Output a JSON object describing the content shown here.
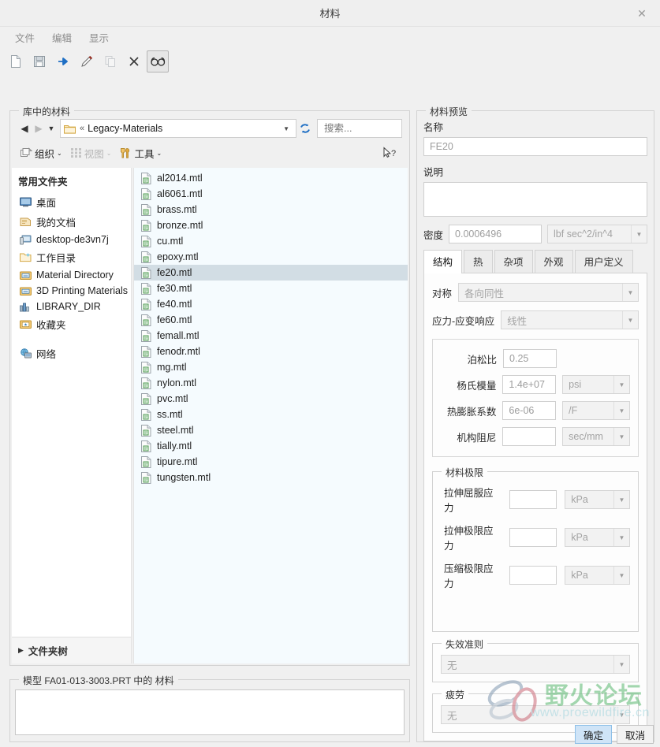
{
  "window": {
    "title": "材料",
    "close_label": "✕"
  },
  "menubar": {
    "items": [
      {
        "label": "文件",
        "icon": "file-menu"
      },
      {
        "label": "编辑",
        "icon": "edit-menu"
      },
      {
        "label": "显示",
        "icon": "view-menu"
      }
    ]
  },
  "toolbar": {
    "buttons": [
      {
        "name": "new-icon",
        "enabled": true
      },
      {
        "name": "save-icon",
        "enabled": true
      },
      {
        "name": "assign-arrow-icon",
        "enabled": true
      },
      {
        "name": "edit-pencil-icon",
        "enabled": true
      },
      {
        "name": "copy-icon",
        "enabled": false
      },
      {
        "name": "delete-x-icon",
        "enabled": true
      },
      {
        "name": "glasses-view-icon",
        "enabled": true,
        "pressed": true
      }
    ]
  },
  "library": {
    "group_title": "库中的材料",
    "nav": {
      "back": "◀",
      "forward": "▶",
      "history_caret": "▼"
    },
    "address": {
      "separator": "«",
      "path": "Legacy-Materials",
      "dropdown_caret": "▼"
    },
    "refresh_label": "⟳",
    "search": {
      "value": "",
      "placeholder": "搜索..."
    },
    "commands": [
      {
        "label": "组织",
        "caret": "⌄",
        "enabled": true
      },
      {
        "label": "视图",
        "caret": "⌄",
        "enabled": false
      },
      {
        "label": "工具",
        "caret": "⌄",
        "enabled": true
      }
    ],
    "help_label": "?",
    "sidebar": {
      "header": "常用文件夹",
      "items": [
        {
          "label": "桌面",
          "icon": "desktop-icon"
        },
        {
          "label": "我的文档",
          "icon": "documents-icon"
        },
        {
          "label": "desktop-de3vn7j",
          "icon": "computer-icon"
        },
        {
          "label": "工作目录",
          "icon": "working-folder-icon"
        },
        {
          "label": "Material Directory",
          "icon": "library-folder-icon"
        },
        {
          "label": "3D Printing Materials",
          "icon": "library-folder-icon"
        },
        {
          "label": "LIBRARY_DIR",
          "icon": "library-chart-icon"
        },
        {
          "label": "收藏夹",
          "icon": "favorites-icon"
        }
      ],
      "network": {
        "label": "网络",
        "icon": "network-icon"
      },
      "folder_tree": {
        "label": "文件夹树",
        "caret": "▶"
      }
    },
    "files": [
      {
        "name": "al2014.mtl",
        "selected": false
      },
      {
        "name": "al6061.mtl",
        "selected": false
      },
      {
        "name": "brass.mtl",
        "selected": false
      },
      {
        "name": "bronze.mtl",
        "selected": false
      },
      {
        "name": "cu.mtl",
        "selected": false
      },
      {
        "name": "epoxy.mtl",
        "selected": false
      },
      {
        "name": "fe20.mtl",
        "selected": true
      },
      {
        "name": "fe30.mtl",
        "selected": false
      },
      {
        "name": "fe40.mtl",
        "selected": false
      },
      {
        "name": "fe60.mtl",
        "selected": false
      },
      {
        "name": "femall.mtl",
        "selected": false
      },
      {
        "name": "fenodr.mtl",
        "selected": false
      },
      {
        "name": "mg.mtl",
        "selected": false
      },
      {
        "name": "nylon.mtl",
        "selected": false
      },
      {
        "name": "pvc.mtl",
        "selected": false
      },
      {
        "name": "ss.mtl",
        "selected": false
      },
      {
        "name": "steel.mtl",
        "selected": false
      },
      {
        "name": "tially.mtl",
        "selected": false
      },
      {
        "name": "tipure.mtl",
        "selected": false
      },
      {
        "name": "tungsten.mtl",
        "selected": false
      }
    ]
  },
  "model_panel": {
    "group_title": "模型 FA01-013-3003.PRT 中的 材料",
    "items": []
  },
  "preview": {
    "group_title": "材料预览",
    "name_label": "名称",
    "name_value": "FE20",
    "desc_label": "说明",
    "desc_value": "",
    "density_label": "密度",
    "density_value": "0.0006496",
    "density_unit": "lbf sec^2/in^4",
    "tabs": [
      {
        "label": "结构",
        "active": true
      },
      {
        "label": "热",
        "active": false
      },
      {
        "label": "杂项",
        "active": false
      },
      {
        "label": "外观",
        "active": false
      },
      {
        "label": "用户定义",
        "active": false
      }
    ],
    "structure": {
      "symmetry_label": "对称",
      "symmetry_value": "各向同性",
      "stress_strain_label": "应力-应变响应",
      "stress_strain_value": "线性",
      "properties": [
        {
          "label": "泊松比",
          "value": "0.25",
          "unit": ""
        },
        {
          "label": "杨氏模量",
          "value": "1.4e+07",
          "unit": "psi"
        },
        {
          "label": "热膨胀系数",
          "value": "6e-06",
          "unit": "/F"
        },
        {
          "label": "机构阻尼",
          "value": "",
          "unit": "sec/mm"
        }
      ]
    },
    "limits": {
      "group_title": "材料极限",
      "rows": [
        {
          "label": "拉伸屈服应力",
          "value": "",
          "unit": "kPa"
        },
        {
          "label": "拉伸极限应力",
          "value": "",
          "unit": "kPa"
        },
        {
          "label": "压缩极限应力",
          "value": "",
          "unit": "kPa"
        }
      ]
    },
    "failure": {
      "group_title": "失效准则",
      "value": "无"
    },
    "fatigue": {
      "group_title": "疲劳",
      "value": "无"
    }
  },
  "dialog_buttons": {
    "ok": "确定",
    "cancel": "取消"
  },
  "watermark": {
    "text": "野火论坛",
    "url": "www.proewildfire.cn",
    "text_color": "#6cbf7e",
    "url_color": "#a9d8e0"
  }
}
